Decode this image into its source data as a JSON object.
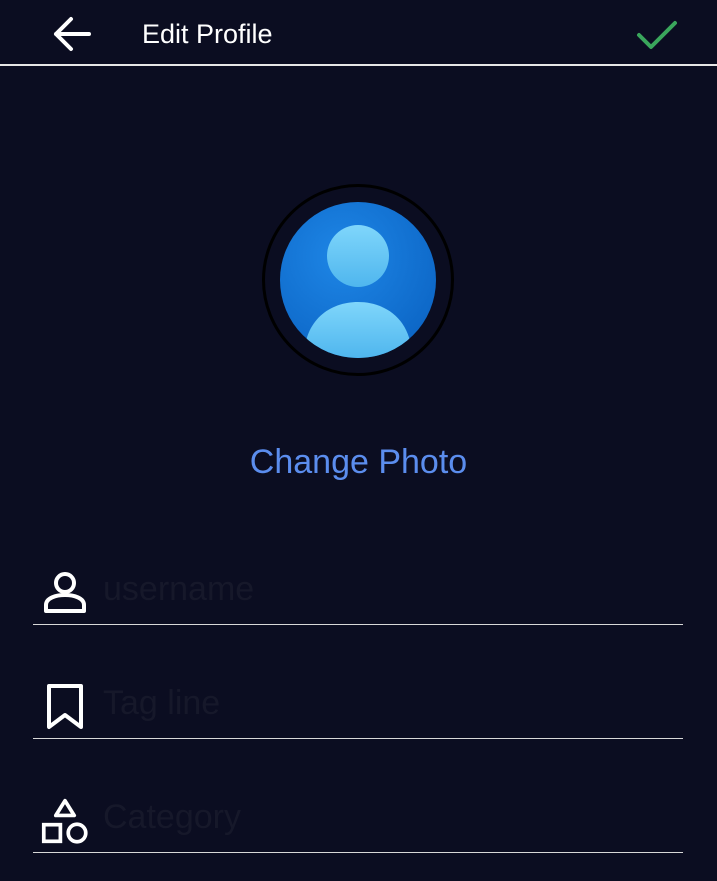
{
  "header": {
    "back_icon": "arrow-left-icon",
    "title": "Edit Profile",
    "confirm_icon": "check-icon",
    "confirm_color": "#3aa65c"
  },
  "avatar": {
    "icon": "user-avatar-icon",
    "circle_color": "#1173d4",
    "figure_color": "#6cc9f5"
  },
  "change_photo": {
    "label": "Change Photo",
    "color": "#5b8dee"
  },
  "fields": [
    {
      "icon": "person-icon",
      "placeholder": "username",
      "value": ""
    },
    {
      "icon": "bookmark-icon",
      "placeholder": "Tag line",
      "value": ""
    },
    {
      "icon": "shapes-icon",
      "placeholder": "Category",
      "value": ""
    }
  ],
  "colors": {
    "background": "#0b0d21",
    "text": "#ffffff",
    "divider": "#d8d8d8"
  }
}
